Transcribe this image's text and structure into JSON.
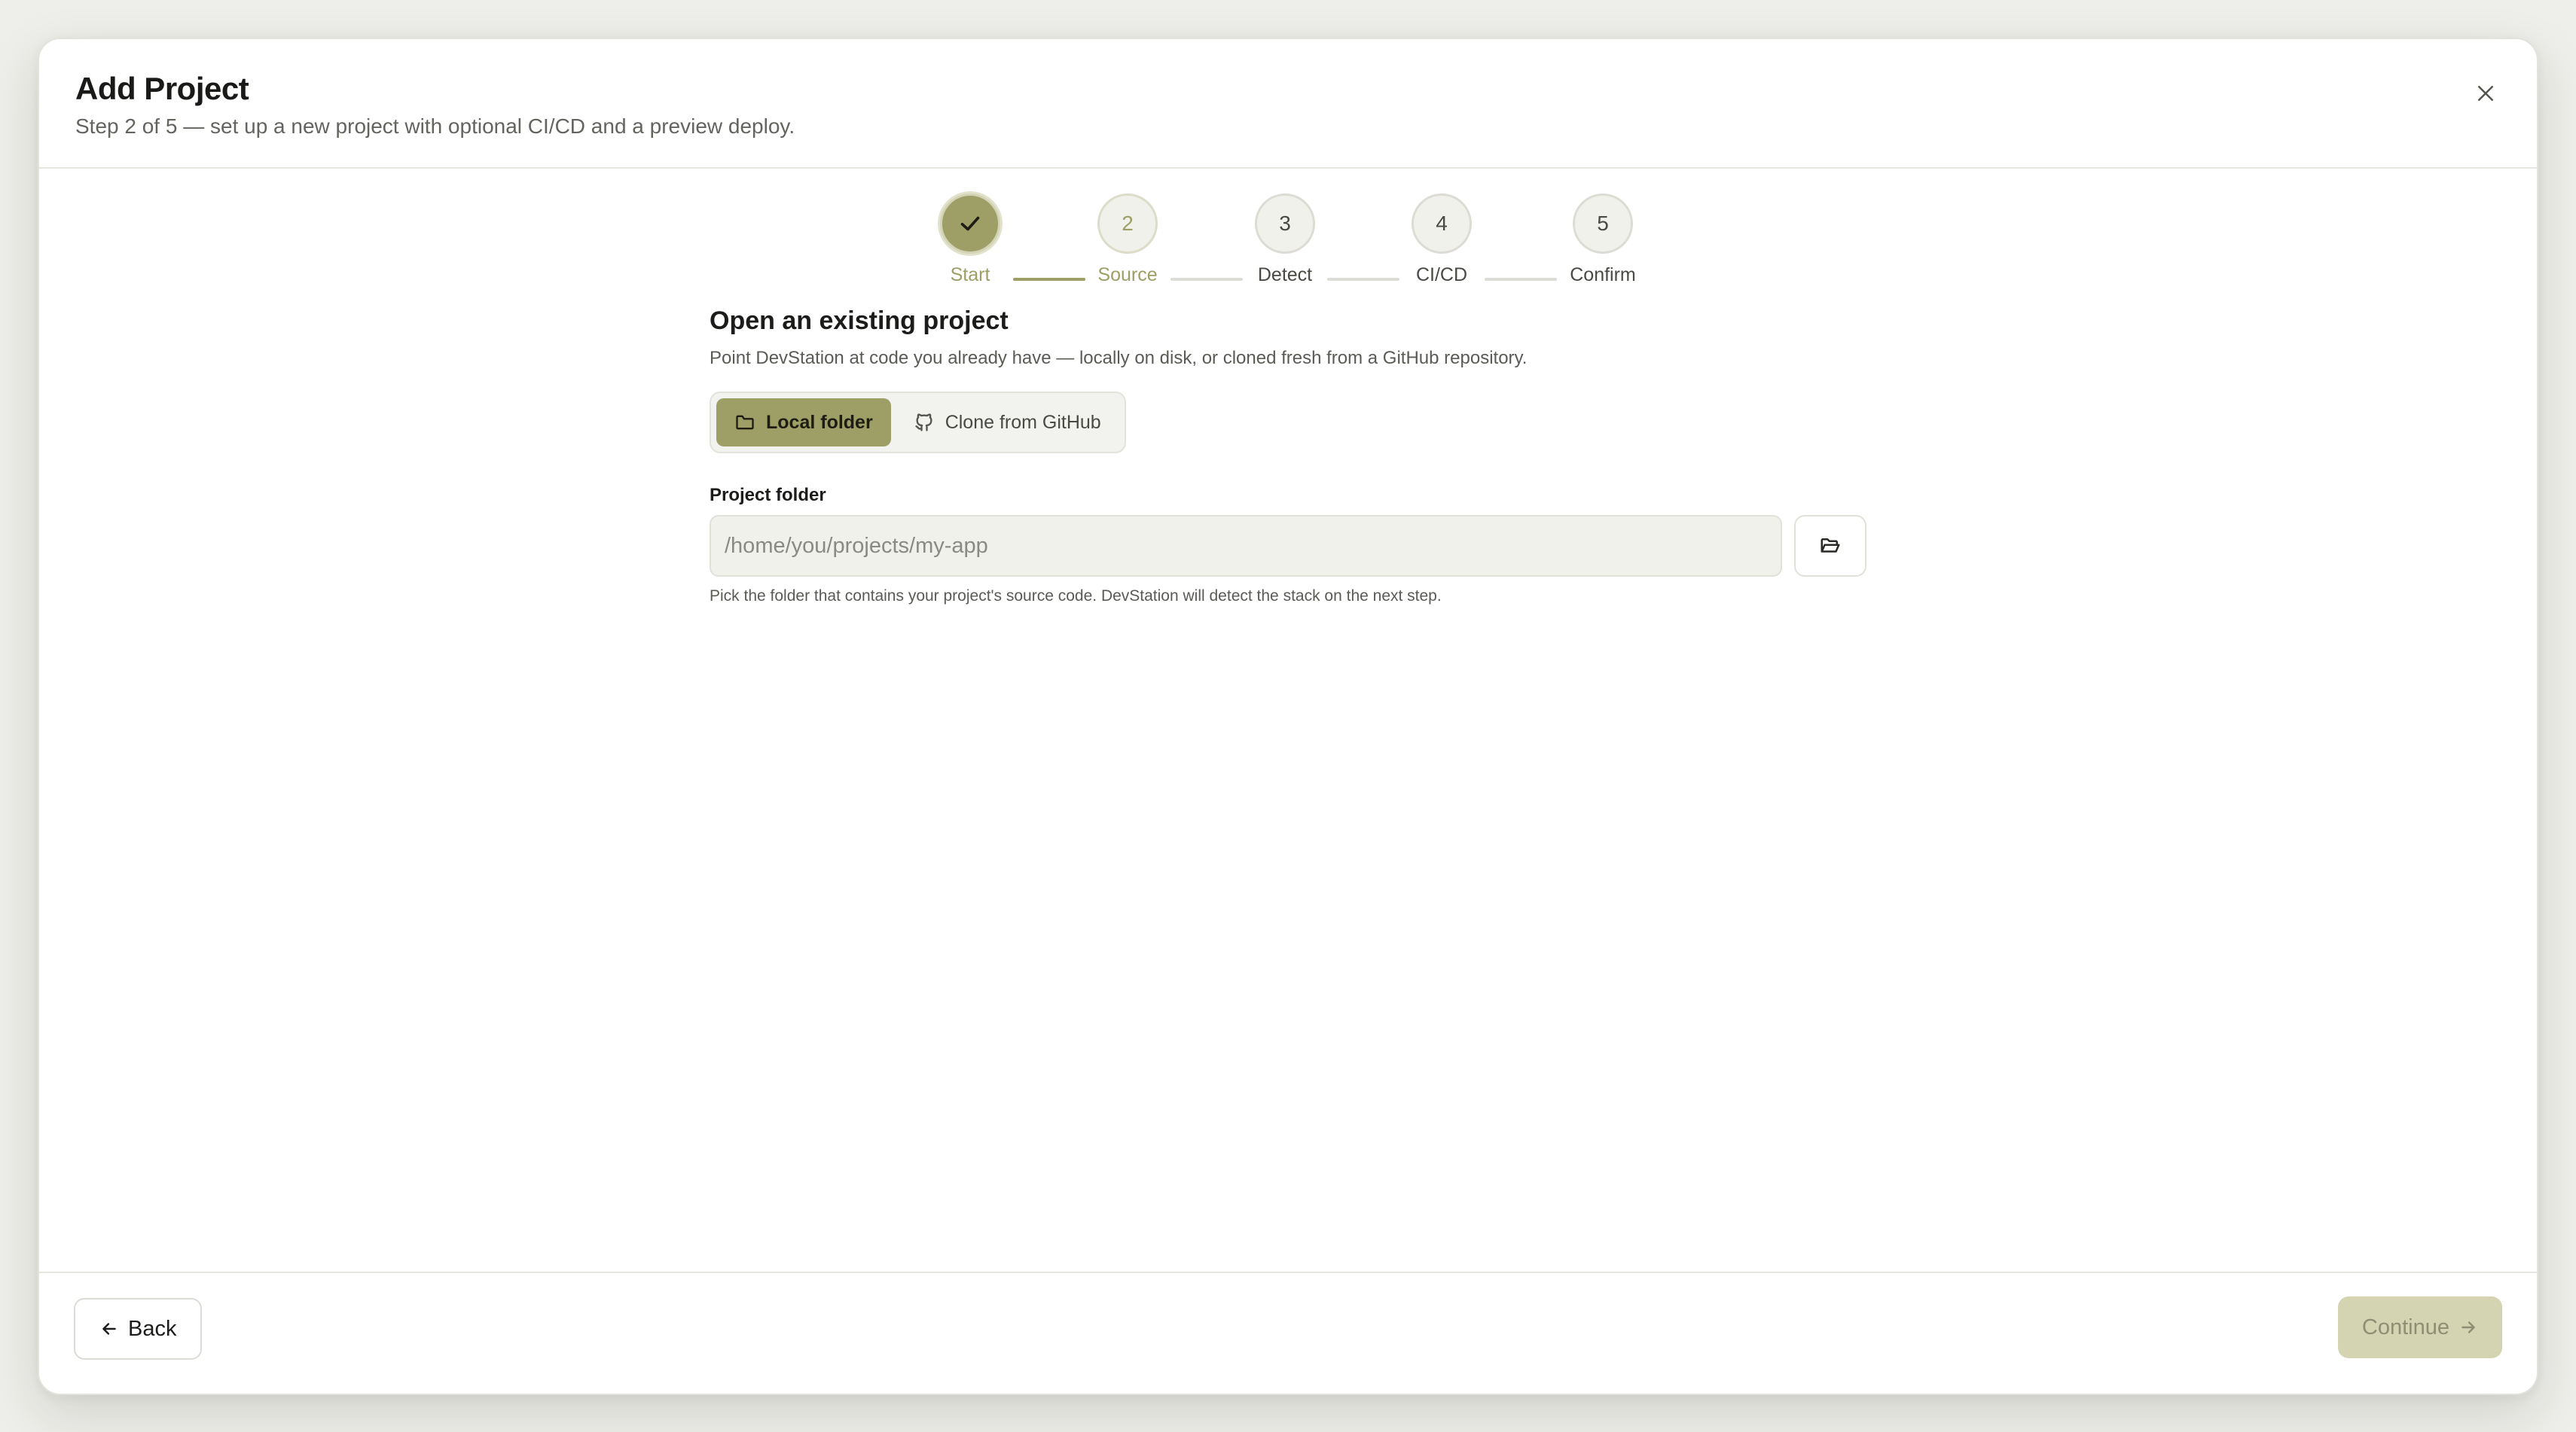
{
  "dialog": {
    "title": "Add Project",
    "subtitle": "Step 2 of 5 — set up a new project with optional CI/CD and a preview deploy."
  },
  "stepper": {
    "steps": [
      {
        "label": "Start",
        "number": "1",
        "state": "done",
        "icon": "check-icon"
      },
      {
        "label": "Source",
        "number": "2",
        "state": "active"
      },
      {
        "label": "Detect",
        "number": "3",
        "state": "pending"
      },
      {
        "label": "CI/CD",
        "number": "4",
        "state": "pending"
      },
      {
        "label": "Confirm",
        "number": "5",
        "state": "pending"
      }
    ]
  },
  "source": {
    "title": "Open an existing project",
    "description": "Point DevStation at code you already have — locally on disk, or cloned fresh from a GitHub repository.",
    "tabs": [
      {
        "label": "Local folder",
        "icon": "folder-icon",
        "selected": true
      },
      {
        "label": "Clone from GitHub",
        "icon": "github-icon",
        "selected": false
      }
    ],
    "folder_label": "Project folder",
    "folder_value": "",
    "folder_placeholder": "/home/you/projects/my-app",
    "browse_icon": "folder-open-icon",
    "hint": "Pick the folder that contains your project's source code. DevStation will detect the stack on the next step."
  },
  "footer": {
    "back_label": "Back",
    "back_icon": "arrow-left-icon",
    "continue_label": "Continue",
    "continue_icon": "arrow-right-icon",
    "continue_enabled": false
  },
  "colors": {
    "accent": "#9d9f67",
    "accent_disabled": "#d4d4b3",
    "background": "#eeeeea",
    "surface": "#ffffff",
    "input_bg": "#f1f1ec"
  }
}
